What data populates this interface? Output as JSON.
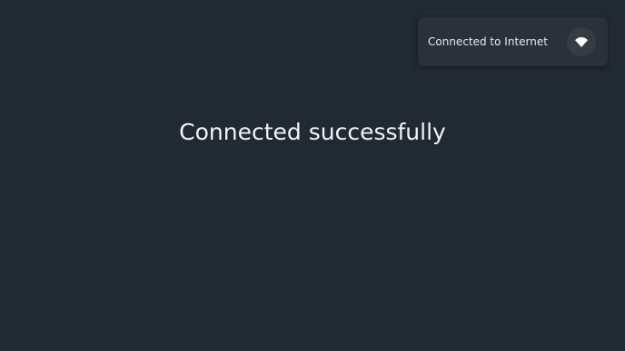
{
  "toast": {
    "message": "Connected to Internet",
    "icon": "wifi-icon"
  },
  "main": {
    "status_message": "Connected successfully"
  },
  "colors": {
    "background": "#222a31",
    "toast_background": "#2a313b",
    "icon_circle": "#343c46",
    "text": "#f2f3f5"
  }
}
